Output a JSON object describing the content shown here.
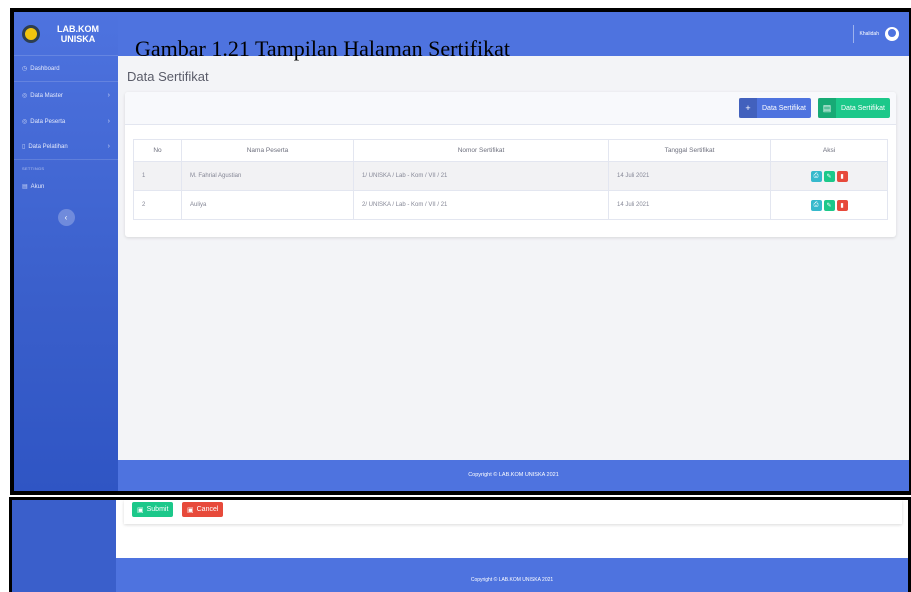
{
  "brand": {
    "line1": "LAB.KOM",
    "line2": "UNISKA"
  },
  "sidebar": {
    "items": [
      {
        "label": "Dashboard",
        "icon": "dashboard-icon",
        "chevron": false
      },
      {
        "label": "Data Master",
        "icon": "database-icon",
        "chevron": true
      },
      {
        "label": "Data Peserta",
        "icon": "users-icon",
        "chevron": true
      },
      {
        "label": "Data Pelatihan",
        "icon": "document-icon",
        "chevron": true
      }
    ],
    "heading": "SETTINGS",
    "account_label": "Akun",
    "toggle_glyph": "‹"
  },
  "topbar": {
    "user_name": "Khalidah"
  },
  "page": {
    "title": "Data Sertifikat"
  },
  "toolbar": {
    "add_label": "Data Sertifikat",
    "report_label": "Data Sertifikat"
  },
  "table": {
    "headers": [
      "No",
      "Nama Peserta",
      "Nomor Sertifikat",
      "Tanggal Sertifikat",
      "Aksi"
    ],
    "rows": [
      {
        "no": "1",
        "nama": "M. Fahrial Agustian",
        "nomor": "1/ UNISKA / Lab - Kom / VII / 21",
        "tanggal": "14 Juli 2021"
      },
      {
        "no": "2",
        "nama": "Auliya",
        "nomor": "2/ UNISKA / Lab - Kom / VII / 21",
        "tanggal": "14 Juli 2021"
      }
    ]
  },
  "footer": {
    "text": "Copyright © LAB.KOM UNISKA 2021"
  },
  "lower": {
    "submit_label": "Submit",
    "cancel_label": "Cancel",
    "footer_text": "Copyright © LAB.KOM UNISKA 2021"
  },
  "caption": "Gambar 1.21 Tampilan Halaman Sertifikat",
  "colors": {
    "primary": "#4e73df",
    "success": "#1cc88a",
    "info": "#36b9cc",
    "danger": "#e74a3b"
  }
}
